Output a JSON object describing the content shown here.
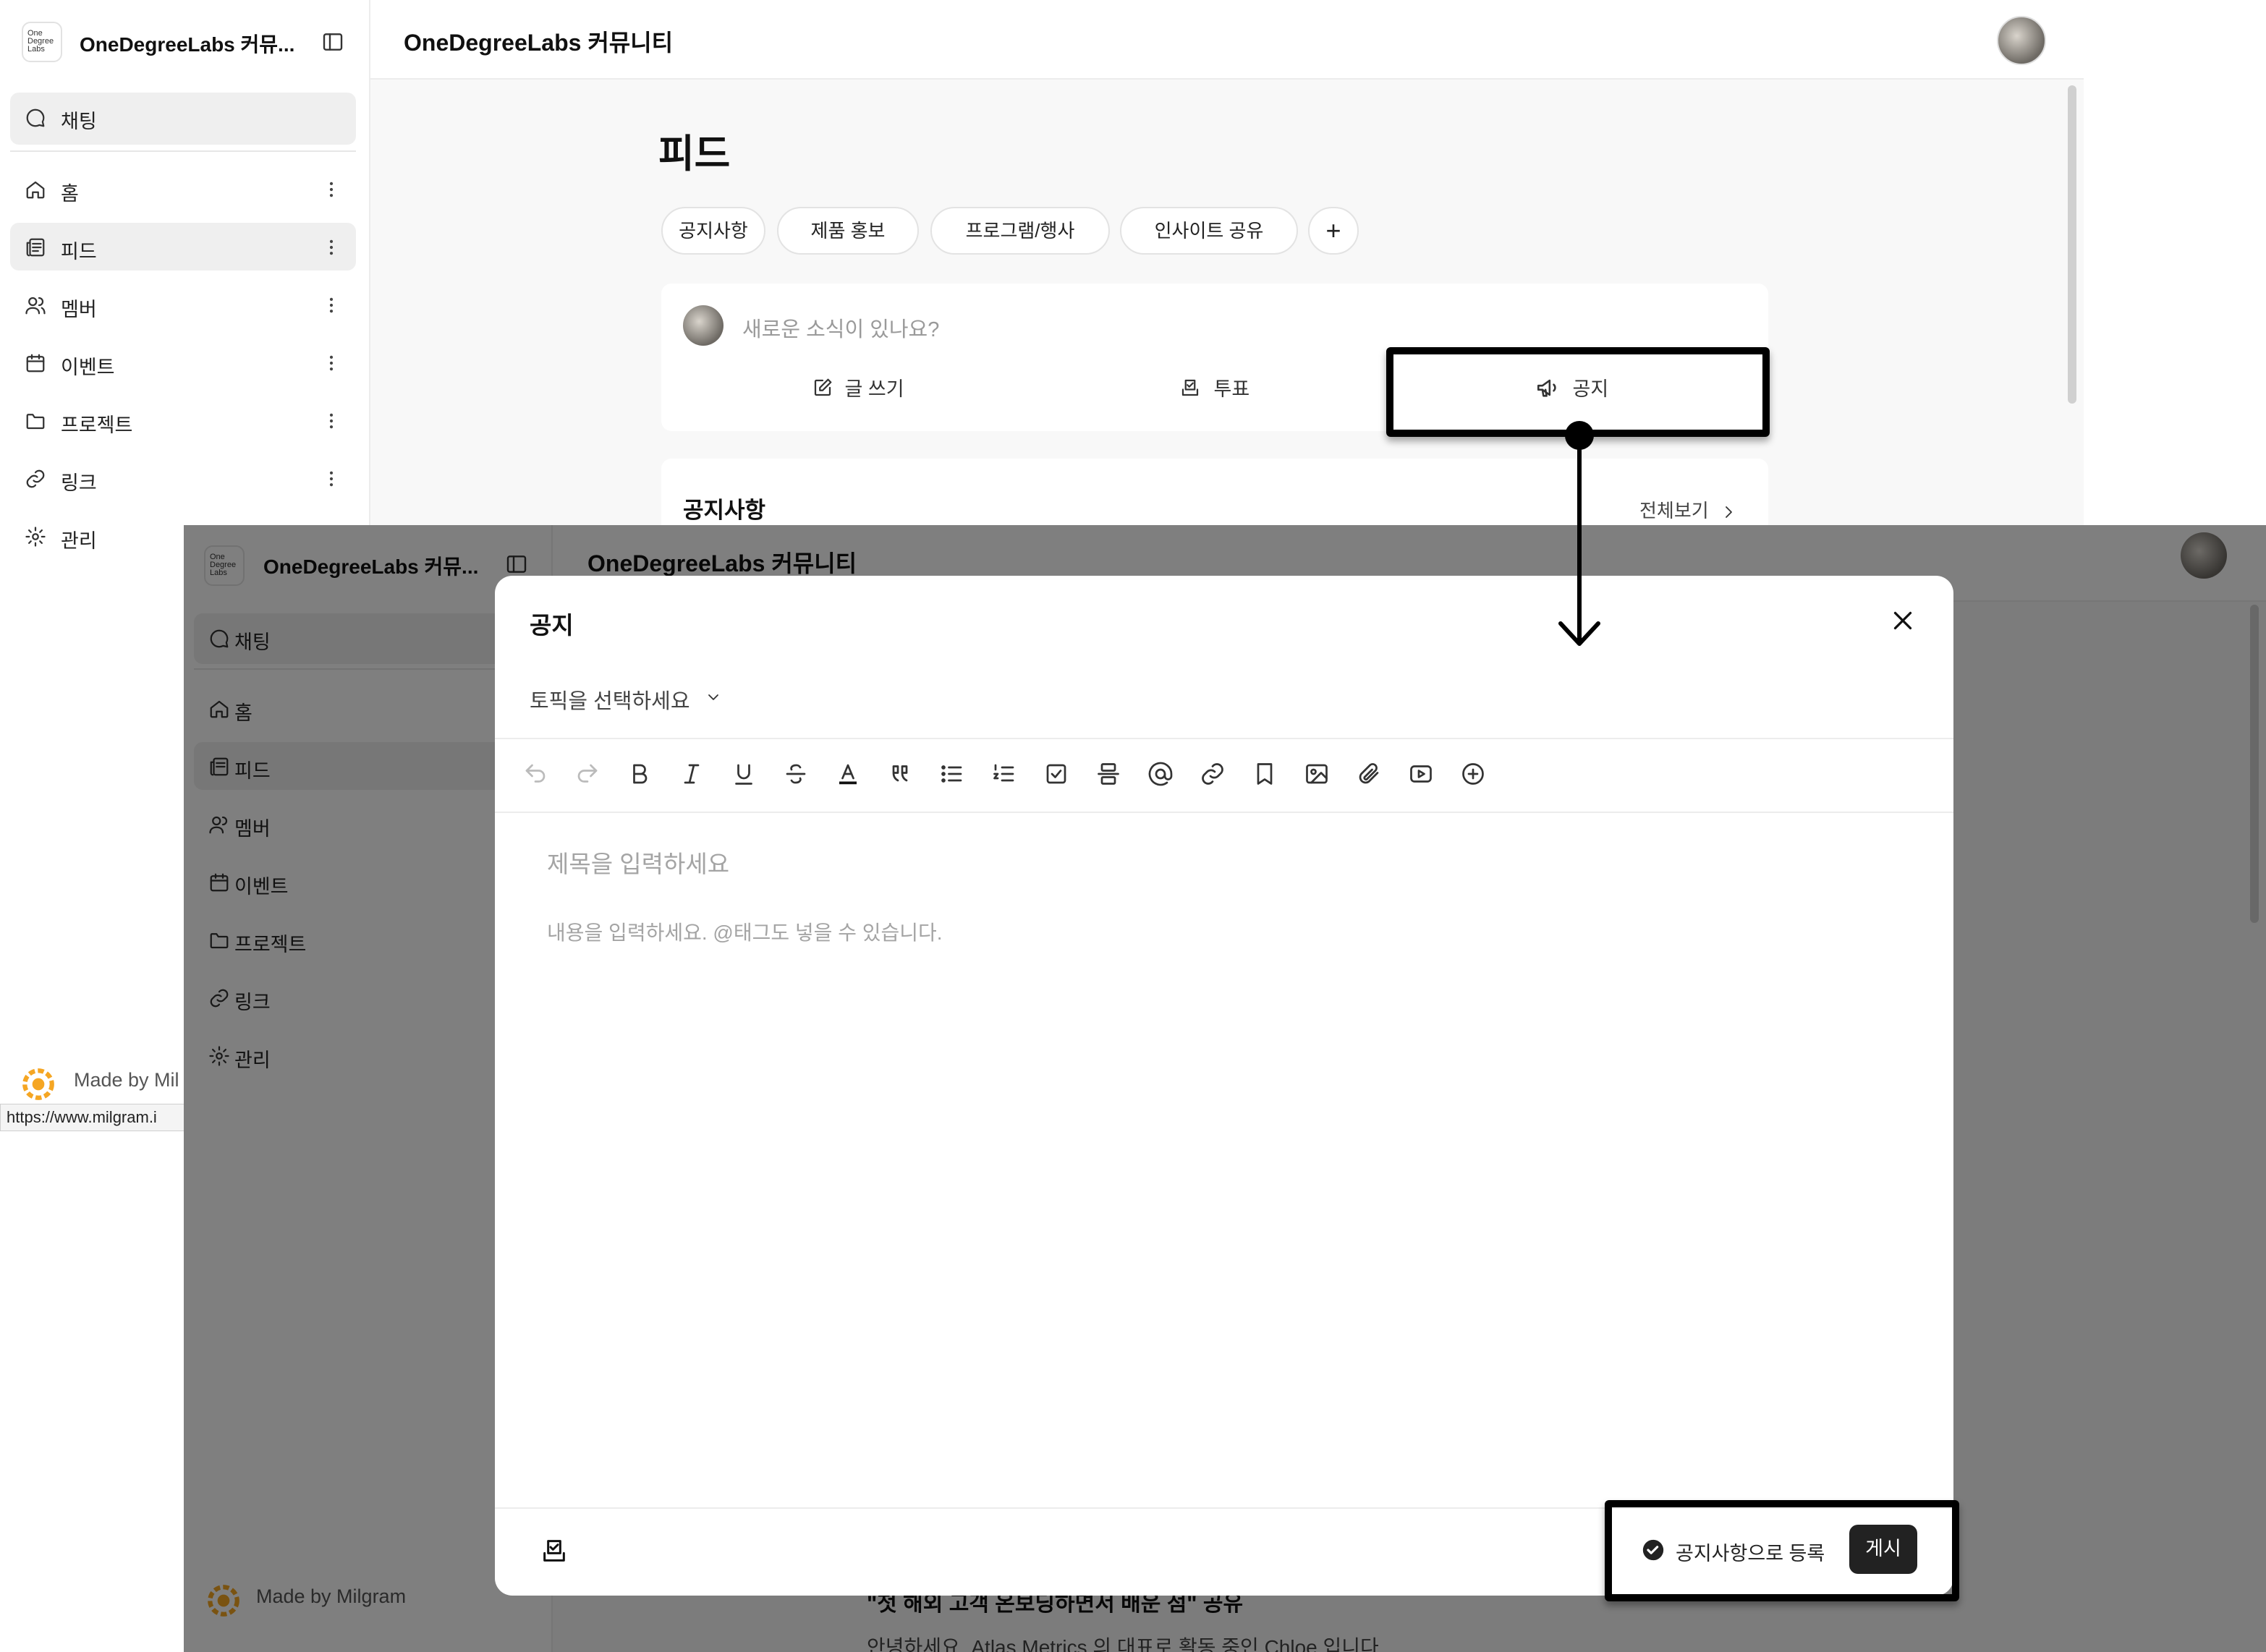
{
  "brand": {
    "logo_text": "One Degree Labs",
    "name_short": "OneDegreeLabs 커뮤...",
    "community_title": "OneDegreeLabs 커뮤니티"
  },
  "sidebar": {
    "chat_label": "채팅",
    "items": [
      {
        "label": "홈",
        "icon": "home-icon"
      },
      {
        "label": "피드",
        "icon": "newspaper-icon"
      },
      {
        "label": "멤버",
        "icon": "users-icon"
      },
      {
        "label": "이벤트",
        "icon": "calendar-icon"
      },
      {
        "label": "프로젝트",
        "icon": "folder-icon"
      },
      {
        "label": "링크",
        "icon": "link-icon"
      },
      {
        "label": "관리",
        "icon": "gear-icon"
      }
    ],
    "footer": "Made by Milgram",
    "footer_clipped": "Made by Mil",
    "tooltip_url": "https://www.milgram.i"
  },
  "feed": {
    "title": "피드",
    "topics": [
      "공지사항",
      "제품 홍보",
      "프로그램/행사",
      "인사이트 공유"
    ],
    "add_topic": "+",
    "compose_placeholder": "새로운 소식이 있나요?",
    "compose_actions": {
      "write": "글 쓰기",
      "vote": "투표",
      "notice": "공지"
    },
    "notice_section_title": "공지사항",
    "view_all": "전체보기",
    "post_title": "\"첫 해외 고객 온보딩하면서 배운 점\" 공유",
    "post_excerpt": "안녕하세요. Atlas Metrics 의 대표로 활동 중인 Chloe 입니다."
  },
  "modal": {
    "title": "공지",
    "topic_placeholder": "토픽을 선택하세요",
    "subject_placeholder": "제목을 입력하세요",
    "body_placeholder": "내용을 입력하세요. @태그도 넣을 수 있습니다.",
    "register_as_notice": "공지사항으로 등록",
    "post_button": "게시",
    "toolbar": [
      "undo-icon",
      "redo-icon",
      "bold-icon",
      "italic-icon",
      "underline-icon",
      "strikethrough-icon",
      "text-color-icon",
      "quote-icon",
      "bullet-list-icon",
      "numbered-list-icon",
      "checklist-icon",
      "divider-icon",
      "mention-icon",
      "link-icon",
      "bookmark-icon",
      "image-icon",
      "attachment-icon",
      "video-icon",
      "add-block-icon"
    ]
  },
  "colors": {
    "accent_dark": "#222222",
    "highlight": "#000000",
    "milgram_orange": "#f5a623"
  }
}
